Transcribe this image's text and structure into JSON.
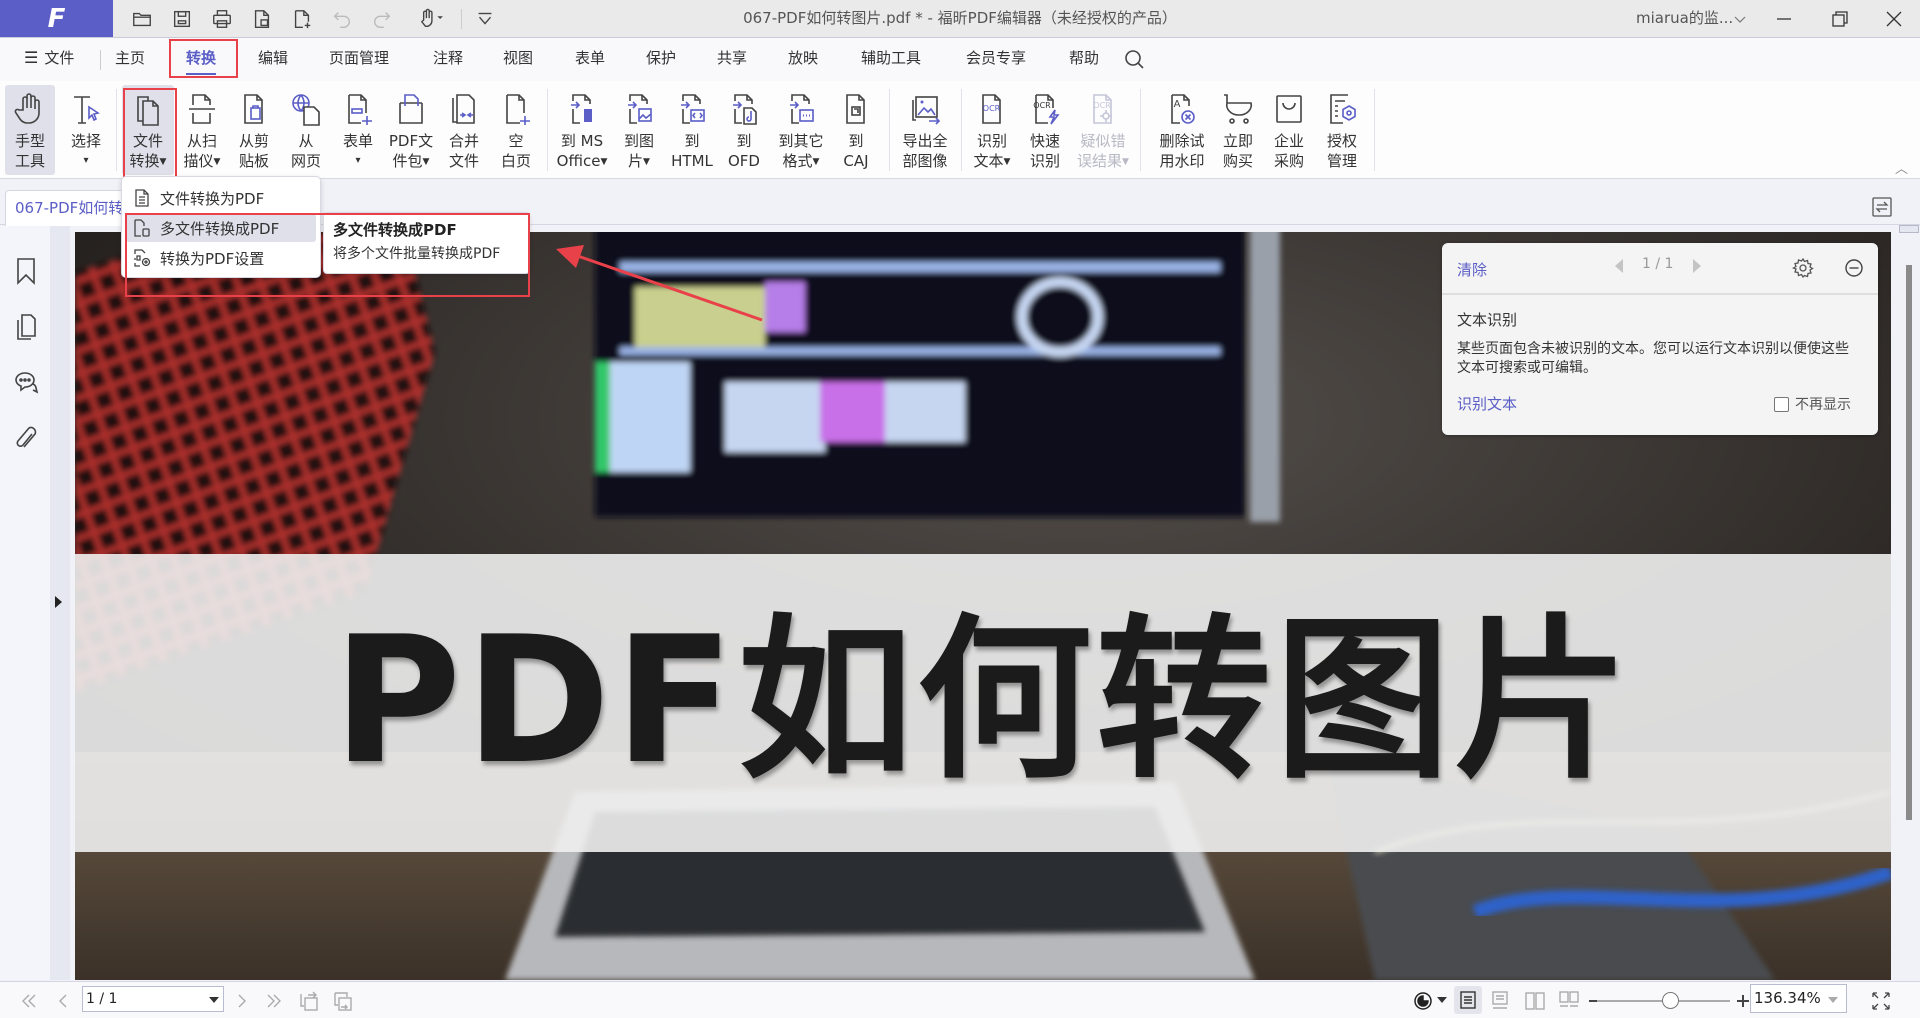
{
  "app": {
    "logo_letter": "F",
    "window_title": "067-PDF如何转图片.pdf * - 福昕PDF编辑器（未经授权的产品）",
    "user_name": "miarua的监...",
    "brand_color": "#5a5ec6",
    "highlight_color": "#e8414a"
  },
  "quick_access": [
    {
      "icon": "open-folder-icon"
    },
    {
      "icon": "save-icon"
    },
    {
      "icon": "print-icon"
    },
    {
      "icon": "document-icon"
    },
    {
      "icon": "new-document-icon"
    },
    {
      "icon": "undo-icon"
    },
    {
      "icon": "redo-icon"
    },
    {
      "icon": "hand-tool-icon"
    },
    {
      "icon": "customize-dropdown-icon"
    }
  ],
  "menu": {
    "file_label": "文件",
    "items": [
      "主页",
      "转换",
      "编辑",
      "页面管理",
      "注释",
      "视图",
      "表单",
      "保护",
      "共享",
      "放映",
      "辅助工具",
      "会员专享",
      "帮助"
    ],
    "active": "转换"
  },
  "ribbon": {
    "buttons": [
      {
        "line1": "手型",
        "line2": "工具",
        "icon": "hand-icon"
      },
      {
        "line1": "选择",
        "line2": "▾",
        "icon": "select-text-icon"
      },
      {
        "line1": "文件",
        "line2": "转换",
        "caret": true,
        "icon": "file-convert-icon",
        "selected": true
      },
      {
        "line1": "从扫",
        "line2": "描仪",
        "caret": true,
        "icon": "scanner-icon"
      },
      {
        "line1": "从剪",
        "line2": "贴板",
        "icon": "clipboard-icon"
      },
      {
        "line1": "从",
        "line2": "网页",
        "icon": "web-page-icon"
      },
      {
        "line1": "表单",
        "line2": "▾",
        "icon": "form-icon"
      },
      {
        "line1": "PDF文",
        "line2": "件包",
        "caret": true,
        "icon": "pdf-portfolio-icon"
      },
      {
        "line1": "合并",
        "line2": "文件",
        "icon": "merge-files-icon"
      },
      {
        "line1": "空",
        "line2": "白页",
        "icon": "blank-page-icon"
      },
      {
        "line1": "到 MS",
        "line2": "Office",
        "caret": true,
        "icon": "to-office-icon"
      },
      {
        "line1": "到图",
        "line2": "片",
        "caret": true,
        "icon": "to-image-icon"
      },
      {
        "line1": "到",
        "line2": "HTML",
        "icon": "to-html-icon"
      },
      {
        "line1": "到",
        "line2": "OFD",
        "icon": "to-ofd-icon"
      },
      {
        "line1": "到其它",
        "line2": "格式",
        "caret": true,
        "icon": "to-other-format-icon"
      },
      {
        "line1": "到",
        "line2": "CAJ",
        "icon": "to-caj-icon"
      },
      {
        "line1": "导出全",
        "line2": "部图像",
        "icon": "export-images-icon"
      },
      {
        "line1": "识别",
        "line2": "文本",
        "caret": true,
        "icon": "ocr-icon"
      },
      {
        "line1": "快速",
        "line2": "识别",
        "icon": "quick-ocr-icon"
      },
      {
        "line1": "疑似错",
        "line2": "误结果",
        "caret": true,
        "icon": "ocr-suspect-icon",
        "disabled": true
      },
      {
        "line1": "删除试",
        "line2": "用水印",
        "icon": "remove-watermark-icon"
      },
      {
        "line1": "立即",
        "line2": "购买",
        "icon": "cart-icon"
      },
      {
        "line1": "企业",
        "line2": "采购",
        "icon": "shopping-bag-icon"
      },
      {
        "line1": "授权",
        "line2": "管理",
        "icon": "license-icon"
      }
    ]
  },
  "dropdown": {
    "items": [
      {
        "label": "文件转换为PDF",
        "icon": "file-to-pdf-icon"
      },
      {
        "label": "多文件转换成PDF",
        "icon": "batch-convert-icon",
        "hover": true
      },
      {
        "label": "转换为PDF设置",
        "icon": "convert-settings-icon"
      }
    ]
  },
  "tooltip": {
    "title": "多文件转换成PDF",
    "description": "将多个文件批量转换成PDF"
  },
  "doc_tab": {
    "label": "067-PDF如何转图片.pdf"
  },
  "sidebar": {
    "icons": [
      "bookmark-icon",
      "pages-icon",
      "comments-icon",
      "attachment-icon"
    ]
  },
  "page": {
    "banner_text": "PDF如何转图片"
  },
  "ocr_panel": {
    "clear_label": "清除",
    "pager": "1 / 1",
    "title": "文本识别",
    "description": "某些页面包含未被识别的文本。您可以运行文本识别以便使这些文本可搜索或可编辑。",
    "action_label": "识别文本",
    "checkbox_label": "不再显示",
    "checkbox_checked": false
  },
  "statusbar": {
    "page_value": "1 / 1",
    "zoom_value": "136.34%",
    "zoom_slider_fraction": 0.55
  }
}
